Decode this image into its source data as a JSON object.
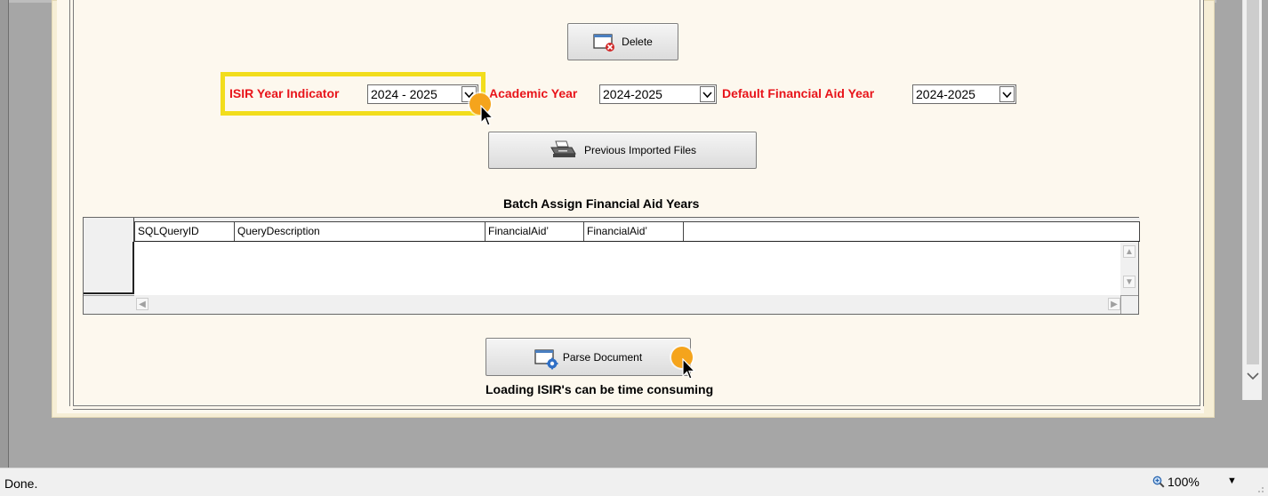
{
  "toolbar": {
    "delete_label": "Delete",
    "previous_files_label": "Previous Imported Files",
    "parse_label": "Parse Document"
  },
  "year_fields": {
    "isir_label": "ISIR Year Indicator",
    "isir_value": "2024 - 2025",
    "academic_label": "Academic Year",
    "academic_value": "2024-2025",
    "default_fa_label": "Default Financial Aid Year",
    "default_fa_value": "2024-2025"
  },
  "grid": {
    "title": "Batch Assign Financial Aid Years",
    "columns": [
      "SQLQueryID",
      "QueryDescription",
      "FinancialAidʼ",
      "FinancialAidʼ"
    ]
  },
  "note": "Loading ISIR's can be time consuming",
  "status": {
    "text": "Done.",
    "zoom": "100%"
  },
  "colors": {
    "label_red": "#e8141a",
    "highlight": "#f2dd1c",
    "cursor_dot": "#f5a41c"
  }
}
